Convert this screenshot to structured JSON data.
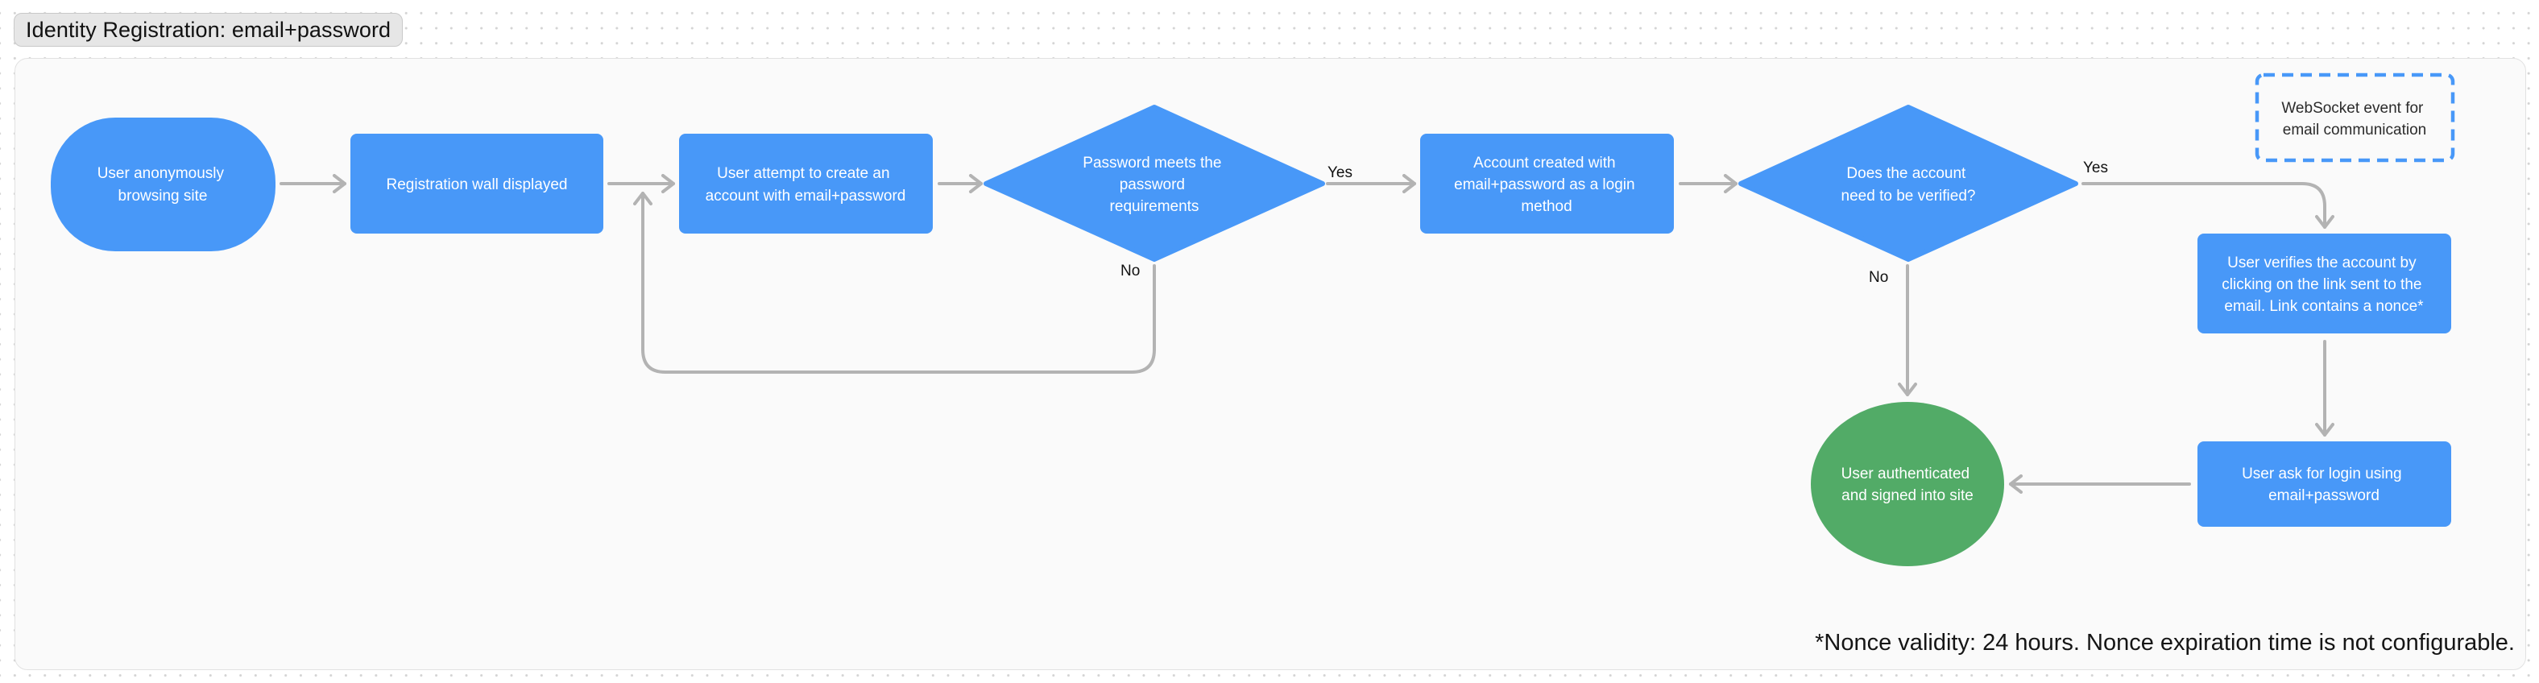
{
  "title": "Identity Registration: email+password",
  "colors": {
    "process": "#4898f8",
    "terminal_success": "#52ab67",
    "note_border": "#4898f8",
    "connector": "#b3b3b3"
  },
  "nodes": {
    "start": {
      "label": [
        "User anonymously",
        "browsing site"
      ],
      "shape": "rounded-terminal"
    },
    "registration_wall": {
      "label": [
        "Registration wall displayed"
      ],
      "shape": "process"
    },
    "attempt_create": {
      "label": [
        "User attempt to create an",
        "account with email+password"
      ],
      "shape": "process"
    },
    "password_check": {
      "label": [
        "Password meets the",
        "password",
        "requirements"
      ],
      "shape": "decision"
    },
    "account_created": {
      "label": [
        "Account created with",
        "email+password as a login",
        "method"
      ],
      "shape": "process"
    },
    "needs_verification": {
      "label": [
        "Does the account",
        "need to be verified?"
      ],
      "shape": "decision"
    },
    "verify_account": {
      "label": [
        "User verifies the account by",
        "clicking on the link sent to the",
        "email. Link contains a nonce*"
      ],
      "shape": "process"
    },
    "login_request": {
      "label": [
        "User ask for login using",
        "email+password"
      ],
      "shape": "process"
    },
    "authenticated": {
      "label": [
        "User authenticated",
        "and signed into site"
      ],
      "shape": "ellipse-terminal"
    },
    "websocket_note": {
      "label": [
        "WebSocket event for",
        "email communication"
      ],
      "shape": "dashed-note"
    }
  },
  "edges": [
    {
      "from": "start",
      "to": "registration_wall",
      "label": ""
    },
    {
      "from": "registration_wall",
      "to": "attempt_create",
      "label": ""
    },
    {
      "from": "attempt_create",
      "to": "password_check",
      "label": ""
    },
    {
      "from": "password_check",
      "to": "account_created",
      "label": "Yes"
    },
    {
      "from": "password_check",
      "to": "attempt_create",
      "label": "No"
    },
    {
      "from": "account_created",
      "to": "needs_verification",
      "label": ""
    },
    {
      "from": "needs_verification",
      "to": "verify_account",
      "label": "Yes"
    },
    {
      "from": "needs_verification",
      "to": "authenticated",
      "label": "No"
    },
    {
      "from": "verify_account",
      "to": "login_request",
      "label": ""
    },
    {
      "from": "login_request",
      "to": "authenticated",
      "label": ""
    }
  ],
  "edge_labels": {
    "password_yes": "Yes",
    "password_no": "No",
    "verify_yes": "Yes",
    "verify_no": "No"
  },
  "footnote": "*Nonce validity: 24 hours. Nonce expiration time is not configurable."
}
